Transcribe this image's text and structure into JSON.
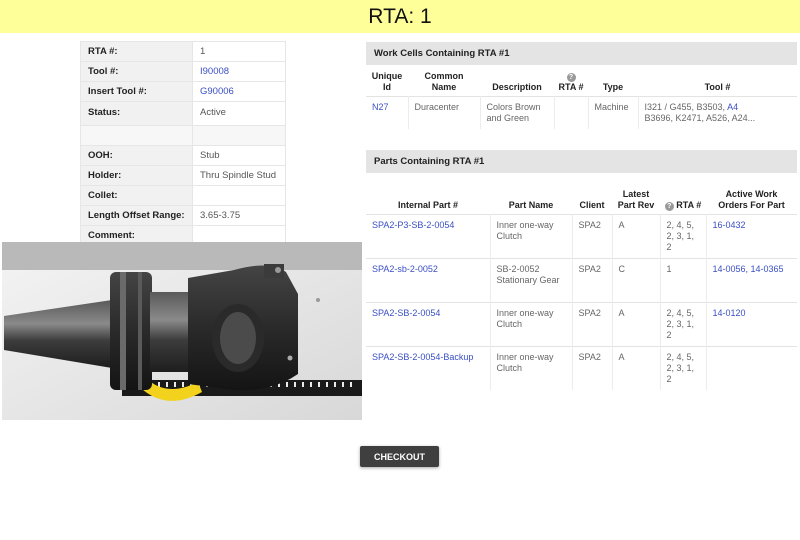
{
  "page": {
    "title": "RTA: 1"
  },
  "details": [
    {
      "key": "RTA #:",
      "value": "1",
      "link": false
    },
    {
      "key": "Tool #:",
      "value": "I90008",
      "link": true
    },
    {
      "key": "Insert Tool #:",
      "value": "G90006",
      "link": true
    },
    {
      "key": "Status:",
      "value": "Active",
      "link": false
    },
    {
      "key": "",
      "value": "",
      "link": false
    },
    {
      "key": "OOH:",
      "value": "Stub",
      "link": false
    },
    {
      "key": "Holder:",
      "value": "Thru Spindle Stud",
      "link": false
    },
    {
      "key": "Collet:",
      "value": "",
      "link": false
    },
    {
      "key": "Length Offset Range:",
      "value": "3.65-3.75",
      "link": false
    },
    {
      "key": "Comment:",
      "value": "",
      "link": false
    }
  ],
  "work_cells": {
    "heading": "Work Cells Containing RTA #1",
    "headers": {
      "unique_id": "Unique Id",
      "common_name": "Common Name",
      "description": "Description",
      "rta": "RTA #",
      "type": "Type",
      "tool": "Tool #"
    },
    "rows": [
      {
        "unique_id": "N27",
        "common_name": "Duracenter",
        "description": "Colors Brown and Green",
        "rta": "",
        "type": "Machine",
        "tool_prefix": "I321 / G455, B3503, ",
        "tool_link": "A4",
        "tool_suffix": "B3696, K2471, A526, A24..."
      }
    ]
  },
  "parts": {
    "heading": "Parts Containing RTA #1",
    "headers": {
      "internal_part": "Internal Part #",
      "part_name": "Part Name",
      "client": "Client",
      "latest_rev": "Latest Part Rev",
      "rta": "RTA #",
      "work_orders": "Active Work Orders For Part"
    },
    "rows": [
      {
        "internal_part": "SPA2-P3-SB-2-0054",
        "part_name": "Inner one-way Clutch",
        "client": "SPA2",
        "rev": "A",
        "rta": "2, 4, 5, 2, 3, 1, 2",
        "work_orders": "16-0432"
      },
      {
        "internal_part": "SPA2-sb-2-0052",
        "part_name": "SB-2-0052 Stationary Gear",
        "client": "SPA2",
        "rev": "C",
        "rta": "1",
        "work_orders": "14-0056, 14-0365"
      },
      {
        "internal_part": "SPA2-SB-2-0054",
        "part_name": "Inner one-way Clutch",
        "client": "SPA2",
        "rev": "A",
        "rta": "2, 4, 5, 2, 3, 1, 2",
        "work_orders": "14-0120"
      },
      {
        "internal_part": "SPA2-SB-2-0054-Backup",
        "part_name": "Inner one-way Clutch",
        "client": "SPA2",
        "rev": "A",
        "rta": "2, 4, 5, 2, 3, 1, 2",
        "work_orders": ""
      }
    ]
  },
  "actions": {
    "checkout_label": "CHECKOUT"
  },
  "icons": {
    "help": "question-circle-icon"
  },
  "colors": {
    "title_bar": "#ffff99",
    "link": "#3a4fc4",
    "section_head": "#e4e4e4",
    "button": "#3f3f3f"
  }
}
